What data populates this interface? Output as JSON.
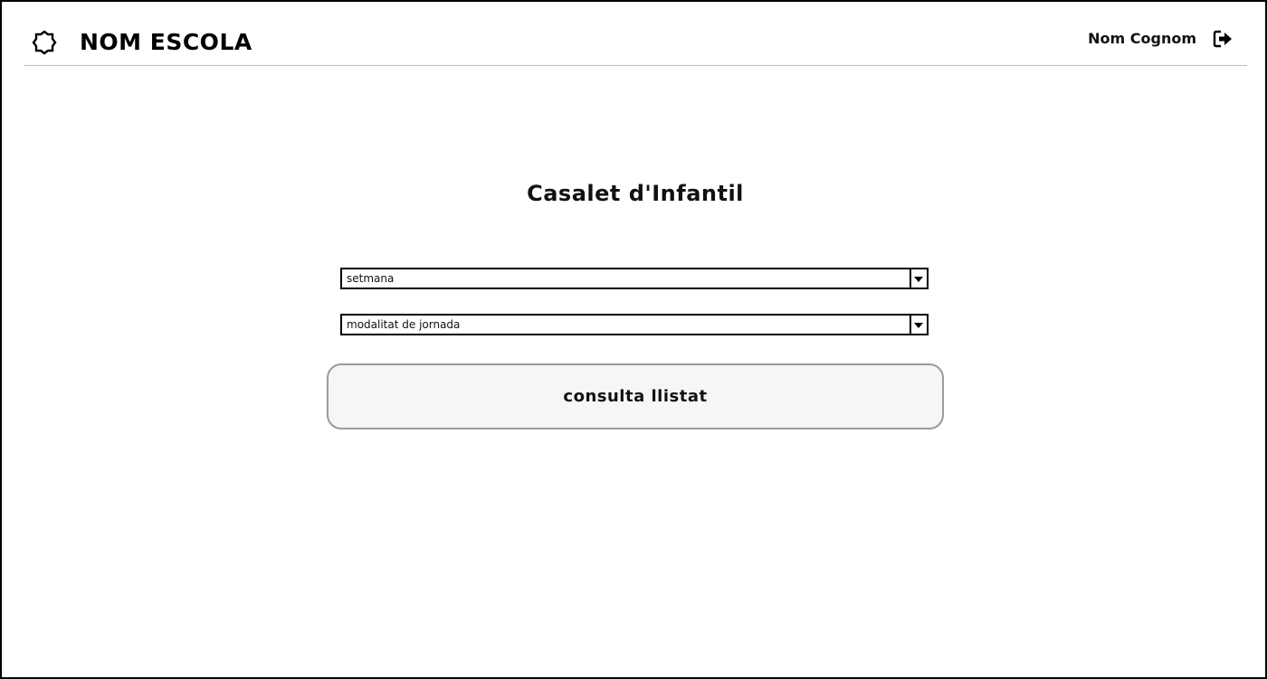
{
  "header": {
    "school_name": "NOM ESCOLA",
    "user_name": "Nom Cognom",
    "logo_icon": "sun-gear-icon",
    "logout_icon": "logout-icon"
  },
  "main": {
    "title": "Casalet d'Infantil",
    "week_select": {
      "value": "setmana"
    },
    "mode_select": {
      "value": "modalitat de jornada"
    },
    "consult_button_label": "consulta llistat"
  }
}
